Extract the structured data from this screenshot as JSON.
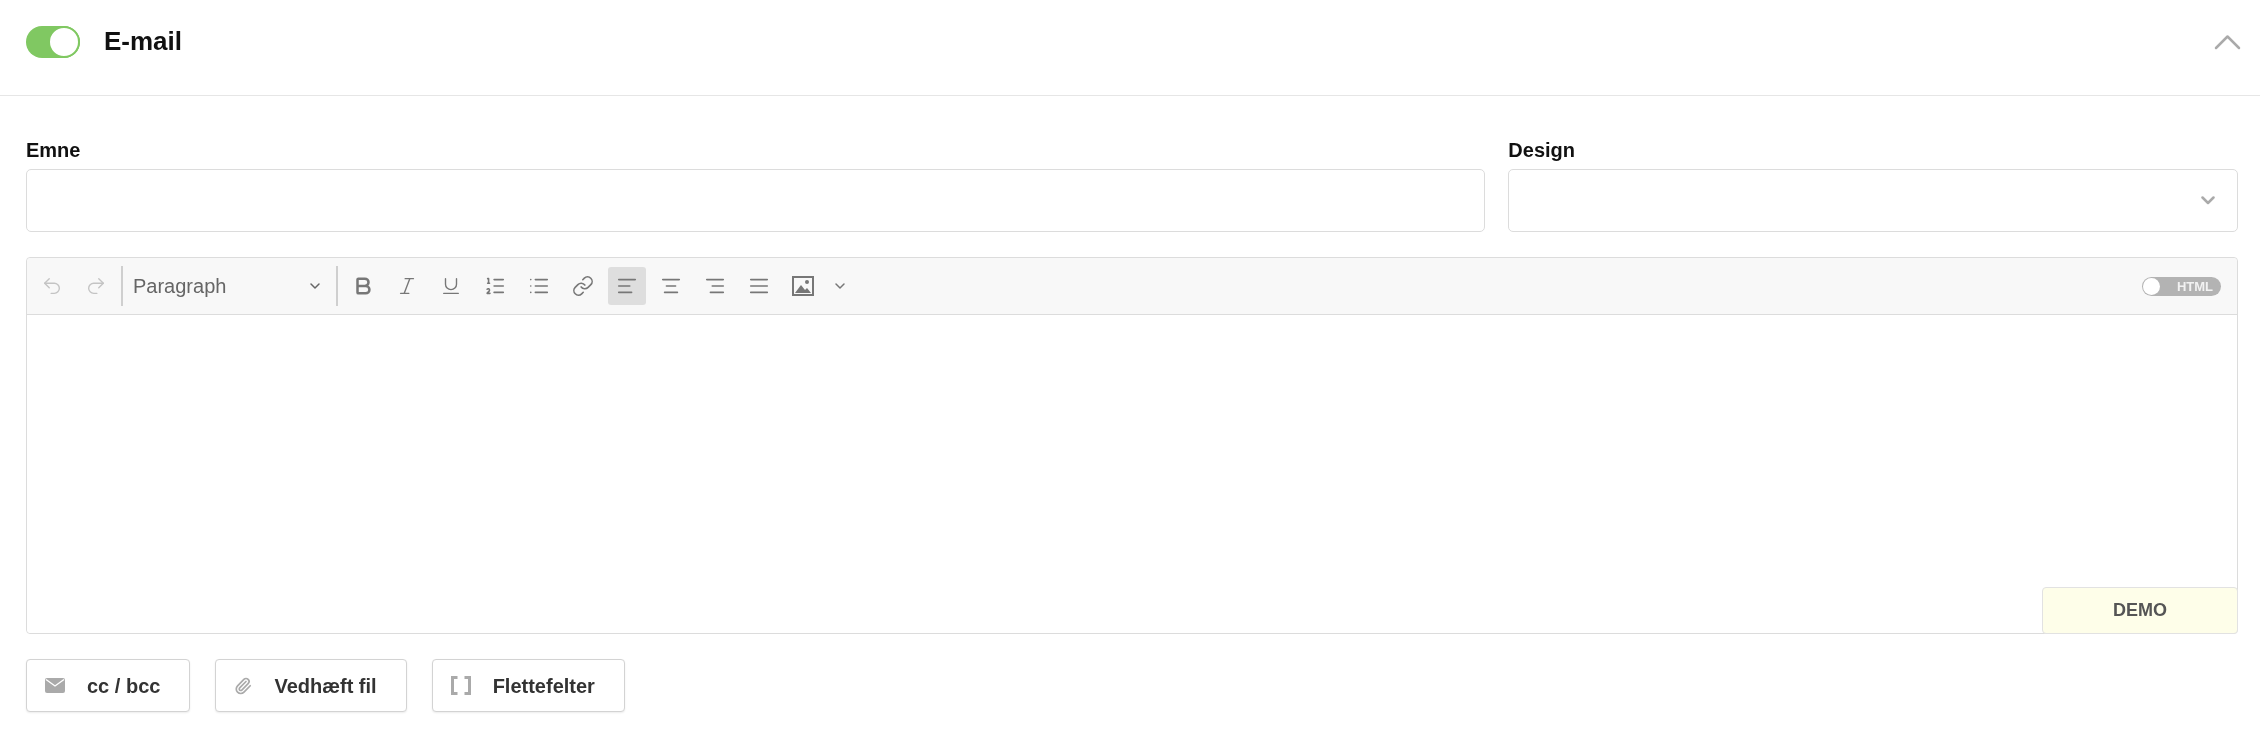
{
  "section": {
    "title": "E-mail",
    "enabled": true,
    "expanded": true
  },
  "fields": [
    {
      "label": "Emne",
      "kind": "text"
    },
    {
      "label": "Design",
      "kind": "select"
    }
  ],
  "editor": {
    "history": [
      {
        "kind": "undo",
        "disabled": true
      },
      {
        "kind": "redo",
        "disabled": true
      }
    ],
    "block_format": "Paragraph",
    "formatting": [
      {
        "kind": "bold"
      },
      {
        "kind": "italic"
      },
      {
        "kind": "underline"
      },
      {
        "kind": "ordered_list"
      },
      {
        "kind": "bullet_list"
      },
      {
        "kind": "link"
      }
    ],
    "alignment": [
      {
        "kind": "left",
        "selected": true
      },
      {
        "kind": "center",
        "selected": false
      },
      {
        "kind": "right",
        "selected": false
      },
      {
        "kind": "justify",
        "selected": false
      }
    ],
    "insert": [
      {
        "kind": "image"
      },
      {
        "kind": "more"
      }
    ],
    "html_toggle": {
      "label": "HTML",
      "on": false
    }
  },
  "demo_badge": "DEMO",
  "actions": [
    {
      "label": "cc / bcc",
      "kind": "cc_bcc"
    },
    {
      "label": "Vedhæft fil",
      "kind": "attach"
    },
    {
      "label": "Flettefelter",
      "kind": "merge_fields"
    }
  ]
}
